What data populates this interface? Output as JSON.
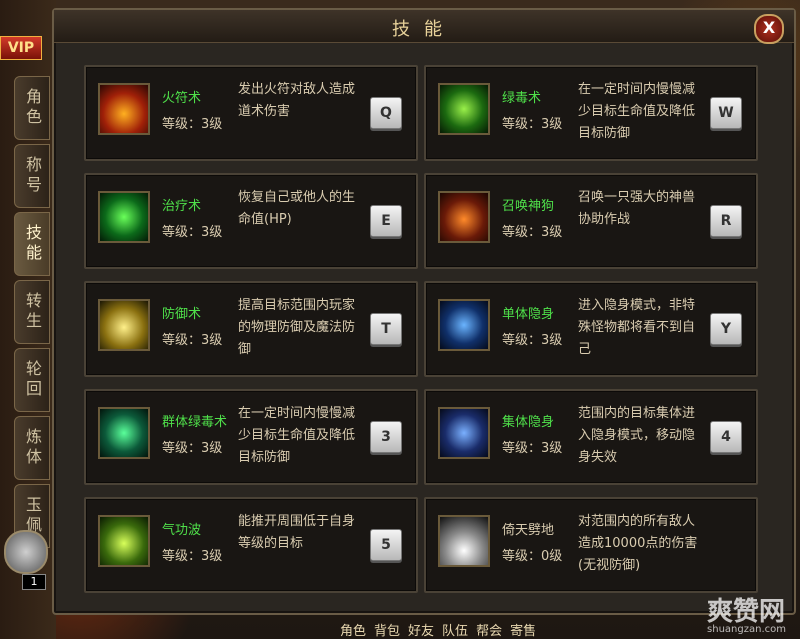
{
  "window": {
    "title": "技能",
    "close_label": "X"
  },
  "vip_label": "VIP",
  "side_tabs": [
    "角色",
    "称号",
    "技能",
    "转生",
    "轮回",
    "炼体",
    "玉佩"
  ],
  "bottom_menu": [
    "角色",
    "背包",
    "好友",
    "队伍",
    "帮会",
    "寄售"
  ],
  "slot_count": "1",
  "skills": [
    {
      "icon": "fire-talisman-icon",
      "name": "火符术",
      "level": "等级：3级",
      "desc": "发出火符对敌人造成道术伤害",
      "key": "Q"
    },
    {
      "icon": "poison-icon",
      "name": "绿毒术",
      "level": "等级：3级",
      "desc": "在一定时间内慢慢减少目标生命值及降低目标防御",
      "key": "W"
    },
    {
      "icon": "heal-icon",
      "name": "治疗术",
      "level": "等级：3级",
      "desc": "恢复自己或他人的生命值(HP)",
      "key": "E"
    },
    {
      "icon": "summon-dog-icon",
      "name": "召唤神狗",
      "level": "等级：3级",
      "desc": "召唤一只强大的神兽协助作战",
      "key": "R"
    },
    {
      "icon": "defense-icon",
      "name": "防御术",
      "level": "等级：3级",
      "desc": "提高目标范围内玩家的物理防御及魔法防御",
      "key": "T"
    },
    {
      "icon": "stealth-icon",
      "name": "单体隐身",
      "level": "等级：3级",
      "desc": "进入隐身模式，非特殊怪物都将看不到自己",
      "key": "Y"
    },
    {
      "icon": "group-poison-icon",
      "name": "群体绿毒术",
      "level": "等级：3级",
      "desc": "在一定时间内慢慢减少目标生命值及降低目标防御",
      "key": "3"
    },
    {
      "icon": "group-stealth-icon",
      "name": "集体隐身",
      "level": "等级：3级",
      "desc": "范围内的目标集体进入隐身模式，移动隐身失效",
      "key": "4"
    },
    {
      "icon": "qigong-wave-icon",
      "name": "气功波",
      "level": "等级：3级",
      "desc": "能推开周围低于自身等级的目标",
      "key": "5"
    },
    {
      "icon": "heaven-field-icon",
      "name": "倚天劈地",
      "level": "等级：0级",
      "desc": "对范围内的所有敌人造成10000点的伤害(无视防御)",
      "key": ""
    }
  ],
  "watermark": {
    "main": "爽赞网",
    "sub": "shuangzan.com"
  }
}
